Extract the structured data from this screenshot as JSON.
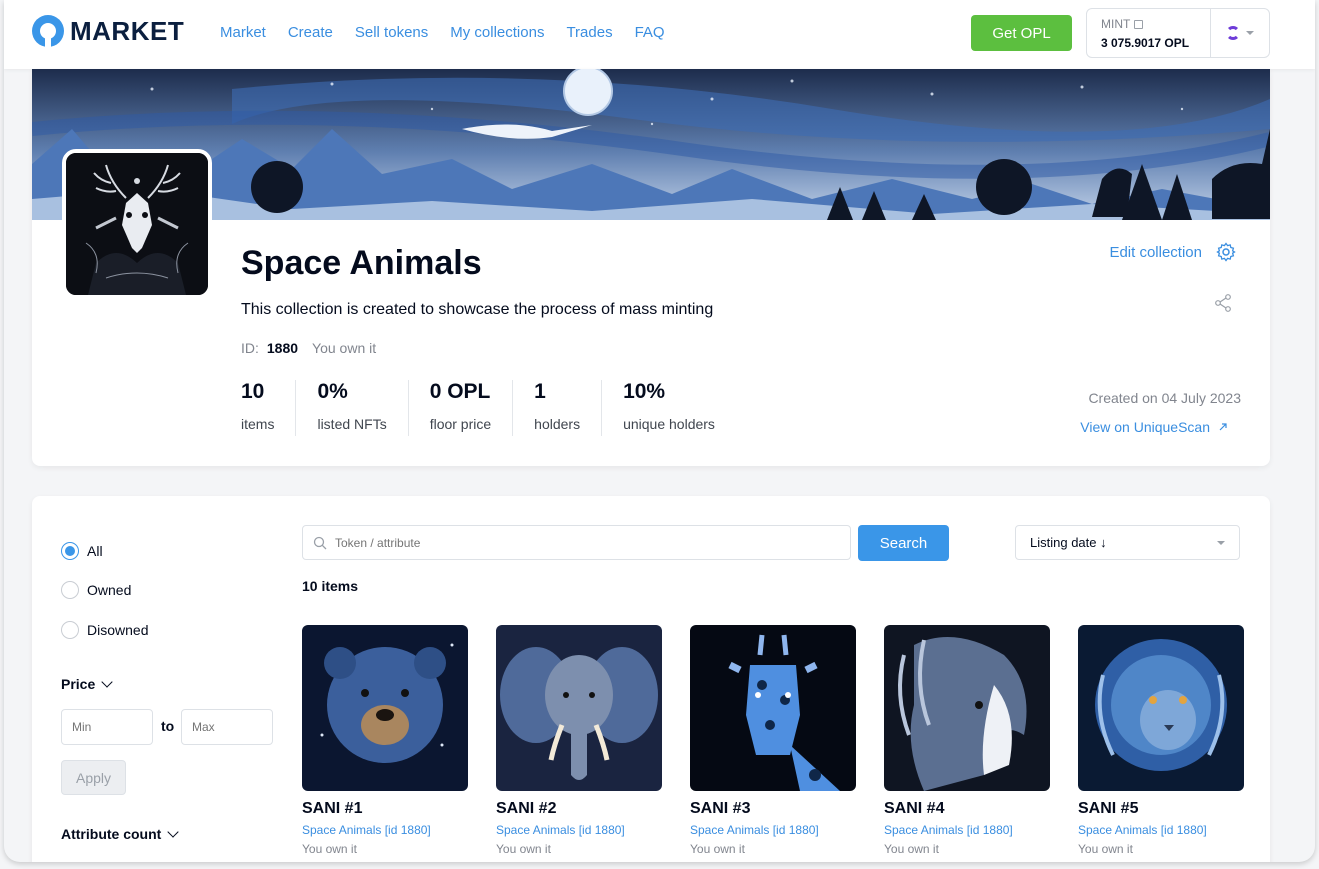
{
  "header": {
    "logo_text": "MARKET",
    "nav": [
      "Market",
      "Create",
      "Sell tokens",
      "My collections",
      "Trades",
      "FAQ"
    ],
    "get_opl_label": "Get OPL",
    "wallet_label": "MINT",
    "wallet_balance": "3 075.9017 OPL"
  },
  "collection": {
    "title": "Space Animals",
    "description": "This collection is created to showcase the process of mass minting",
    "id_label": "ID:",
    "id_value": "1880",
    "ownership": "You own it",
    "edit_label": "Edit collection",
    "created": "Created on 04 July 2023",
    "uniquescan_label": "View on UniqueScan",
    "stats": [
      {
        "value": "10",
        "label": "items"
      },
      {
        "value": "0%",
        "label": "listed NFTs"
      },
      {
        "value": "0 OPL",
        "label": "floor price"
      },
      {
        "value": "1",
        "label": "holders"
      },
      {
        "value": "10%",
        "label": "unique holders"
      }
    ]
  },
  "filters": {
    "radios": [
      {
        "label": "All",
        "selected": true
      },
      {
        "label": "Owned",
        "selected": false
      },
      {
        "label": "Disowned",
        "selected": false
      }
    ],
    "price_label": "Price",
    "min_placeholder": "Min",
    "to_label": "to",
    "max_placeholder": "Max",
    "apply_label": "Apply",
    "attribute_count_label": "Attribute count"
  },
  "search": {
    "placeholder": "Token / attribute",
    "button_label": "Search",
    "sort_label": "Listing date ↓"
  },
  "items_count": "10 items",
  "tokens": [
    {
      "name": "SANI #1",
      "collection": "Space Animals [id 1880]",
      "ownership": "You own it"
    },
    {
      "name": "SANI #2",
      "collection": "Space Animals [id 1880]",
      "ownership": "You own it"
    },
    {
      "name": "SANI #3",
      "collection": "Space Animals [id 1880]",
      "ownership": "You own it"
    },
    {
      "name": "SANI #4",
      "collection": "Space Animals [id 1880]",
      "ownership": "You own it"
    },
    {
      "name": "SANI #5",
      "collection": "Space Animals [id 1880]",
      "ownership": "You own it"
    }
  ],
  "colors": {
    "accent": "#3a96e8",
    "link": "#3a8ee0",
    "green": "#5cbf3f"
  }
}
